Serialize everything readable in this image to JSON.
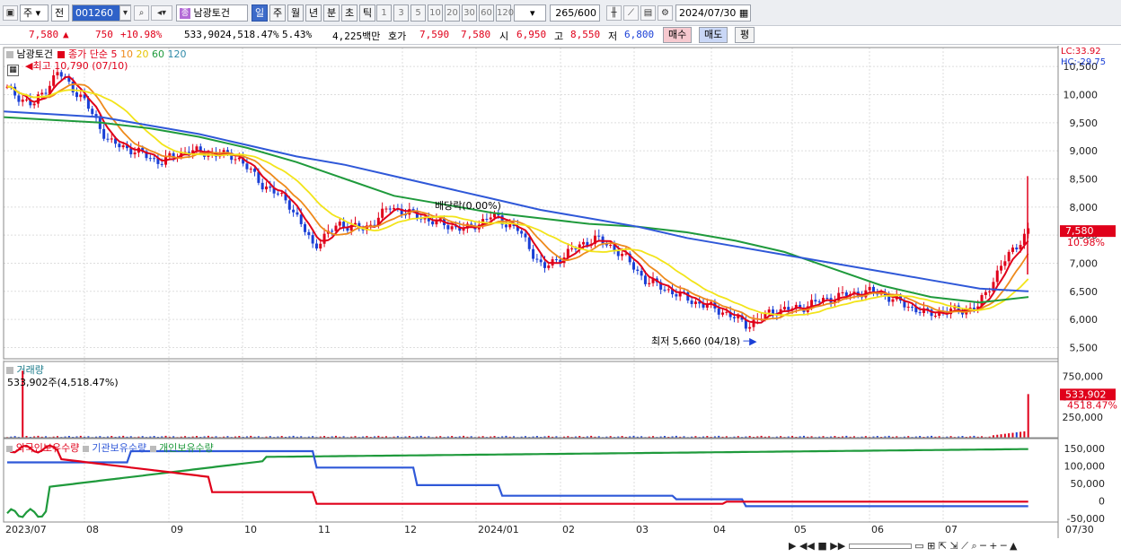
{
  "toolbar": {
    "period_mode": "주",
    "prev_label": "전",
    "code": "001260",
    "stock_name": "남광토건",
    "periods": [
      "일",
      "주",
      "월",
      "년",
      "분",
      "초",
      "틱"
    ],
    "active_period": "일",
    "intervals": [
      "1",
      "3",
      "5",
      "10",
      "20",
      "30",
      "60",
      "120"
    ],
    "count_value": "265",
    "count_max": "/600",
    "date": "2024/07/30"
  },
  "quote": {
    "price": "7,580",
    "arrow": "▲",
    "change": "750",
    "change_pct": "+10.98%",
    "volume": "533,902",
    "volume_ratio": "4,518.47%",
    "turnover": "5.43%",
    "amount": "4,225백만",
    "bid_label": "호가",
    "ask_price": "7,590",
    "bid_price": "7,580",
    "open_label": "시",
    "open": "6,950",
    "high_label": "고",
    "high": "8,550",
    "low_label": "저",
    "low": "6,800",
    "buy_label": "매수",
    "sell_label": "매도",
    "avg_label": "평"
  },
  "price_panel": {
    "name": "남광토건",
    "ma_title": "종가 단순",
    "ma_periods": [
      "5",
      "10",
      "20",
      "60",
      "120"
    ],
    "ma_colors": [
      "#e0001a",
      "#ee8a1c",
      "#f2e41a",
      "#1f9a3c",
      "#2f58d8"
    ],
    "high_marker": "최고 10,790 (07/10)",
    "low_marker": "최저 5,660 (04/18)",
    "dividend_label": "배당락(0.00%)",
    "lc": "LC:33.92",
    "hc": "HC:-29.75",
    "y_ticks": [
      "10,500",
      "10,000",
      "9,500",
      "9,000",
      "8,500",
      "8,000",
      "7,500",
      "7,000",
      "6,500",
      "6,000",
      "5,500"
    ],
    "current_price_tag": "7,580",
    "current_pct_tag": "10.98%"
  },
  "volume_panel": {
    "title": "거래량",
    "value_label": "533,902주(4,518.47%)",
    "y_ticks": [
      "750,000",
      "500,000",
      "250,000"
    ],
    "current_tag": "533,902",
    "current_pct_tag": "4518.47%"
  },
  "holders_panel": {
    "series_names": [
      "외국인보유수량",
      "기관보유수량",
      "개인보유수량"
    ],
    "series_colors": [
      "#e0001a",
      "#2f58d8",
      "#1f9a3c"
    ],
    "y_ticks": [
      "150,000",
      "100,000",
      "50,000",
      "0",
      "-50,000"
    ]
  },
  "x_axis": {
    "labels": [
      "2023/07",
      "08",
      "09",
      "10",
      "11",
      "12",
      "2024/01",
      "02",
      "03",
      "04",
      "05",
      "06",
      "07"
    ],
    "end_label": "07/30"
  },
  "chart_data": {
    "type": "line",
    "series": [
      {
        "name": "종가",
        "values": [
          10100,
          9800,
          10400,
          9900,
          9150,
          9000,
          8800,
          9000,
          8950,
          8900,
          8400,
          8100,
          7300,
          7700,
          7600,
          8000,
          7850,
          7700,
          7600,
          7850,
          7600,
          6900,
          7200,
          7450,
          7200,
          6700,
          6500,
          6300,
          6150,
          5900,
          6150,
          6200,
          6350,
          6450,
          6500,
          6300,
          6100,
          6150,
          6200,
          7000,
          7580
        ]
      },
      {
        "name": "120",
        "values": [
          9700,
          9650,
          9600,
          9450,
          9300,
          9100,
          8900,
          8750,
          8550,
          8350,
          8150,
          7950,
          7800,
          7650,
          7450,
          7300,
          7150,
          7000,
          6850,
          6700,
          6550,
          6500
        ]
      },
      {
        "name": "60",
        "values": [
          9600,
          9550,
          9500,
          9400,
          9250,
          9050,
          8800,
          8500,
          8200,
          8050,
          7900,
          7800,
          7700,
          7650,
          7550,
          7400,
          7200,
          6900,
          6600,
          6400,
          6300,
          6400
        ]
      }
    ],
    "ylim": [
      5500,
      10790
    ]
  }
}
